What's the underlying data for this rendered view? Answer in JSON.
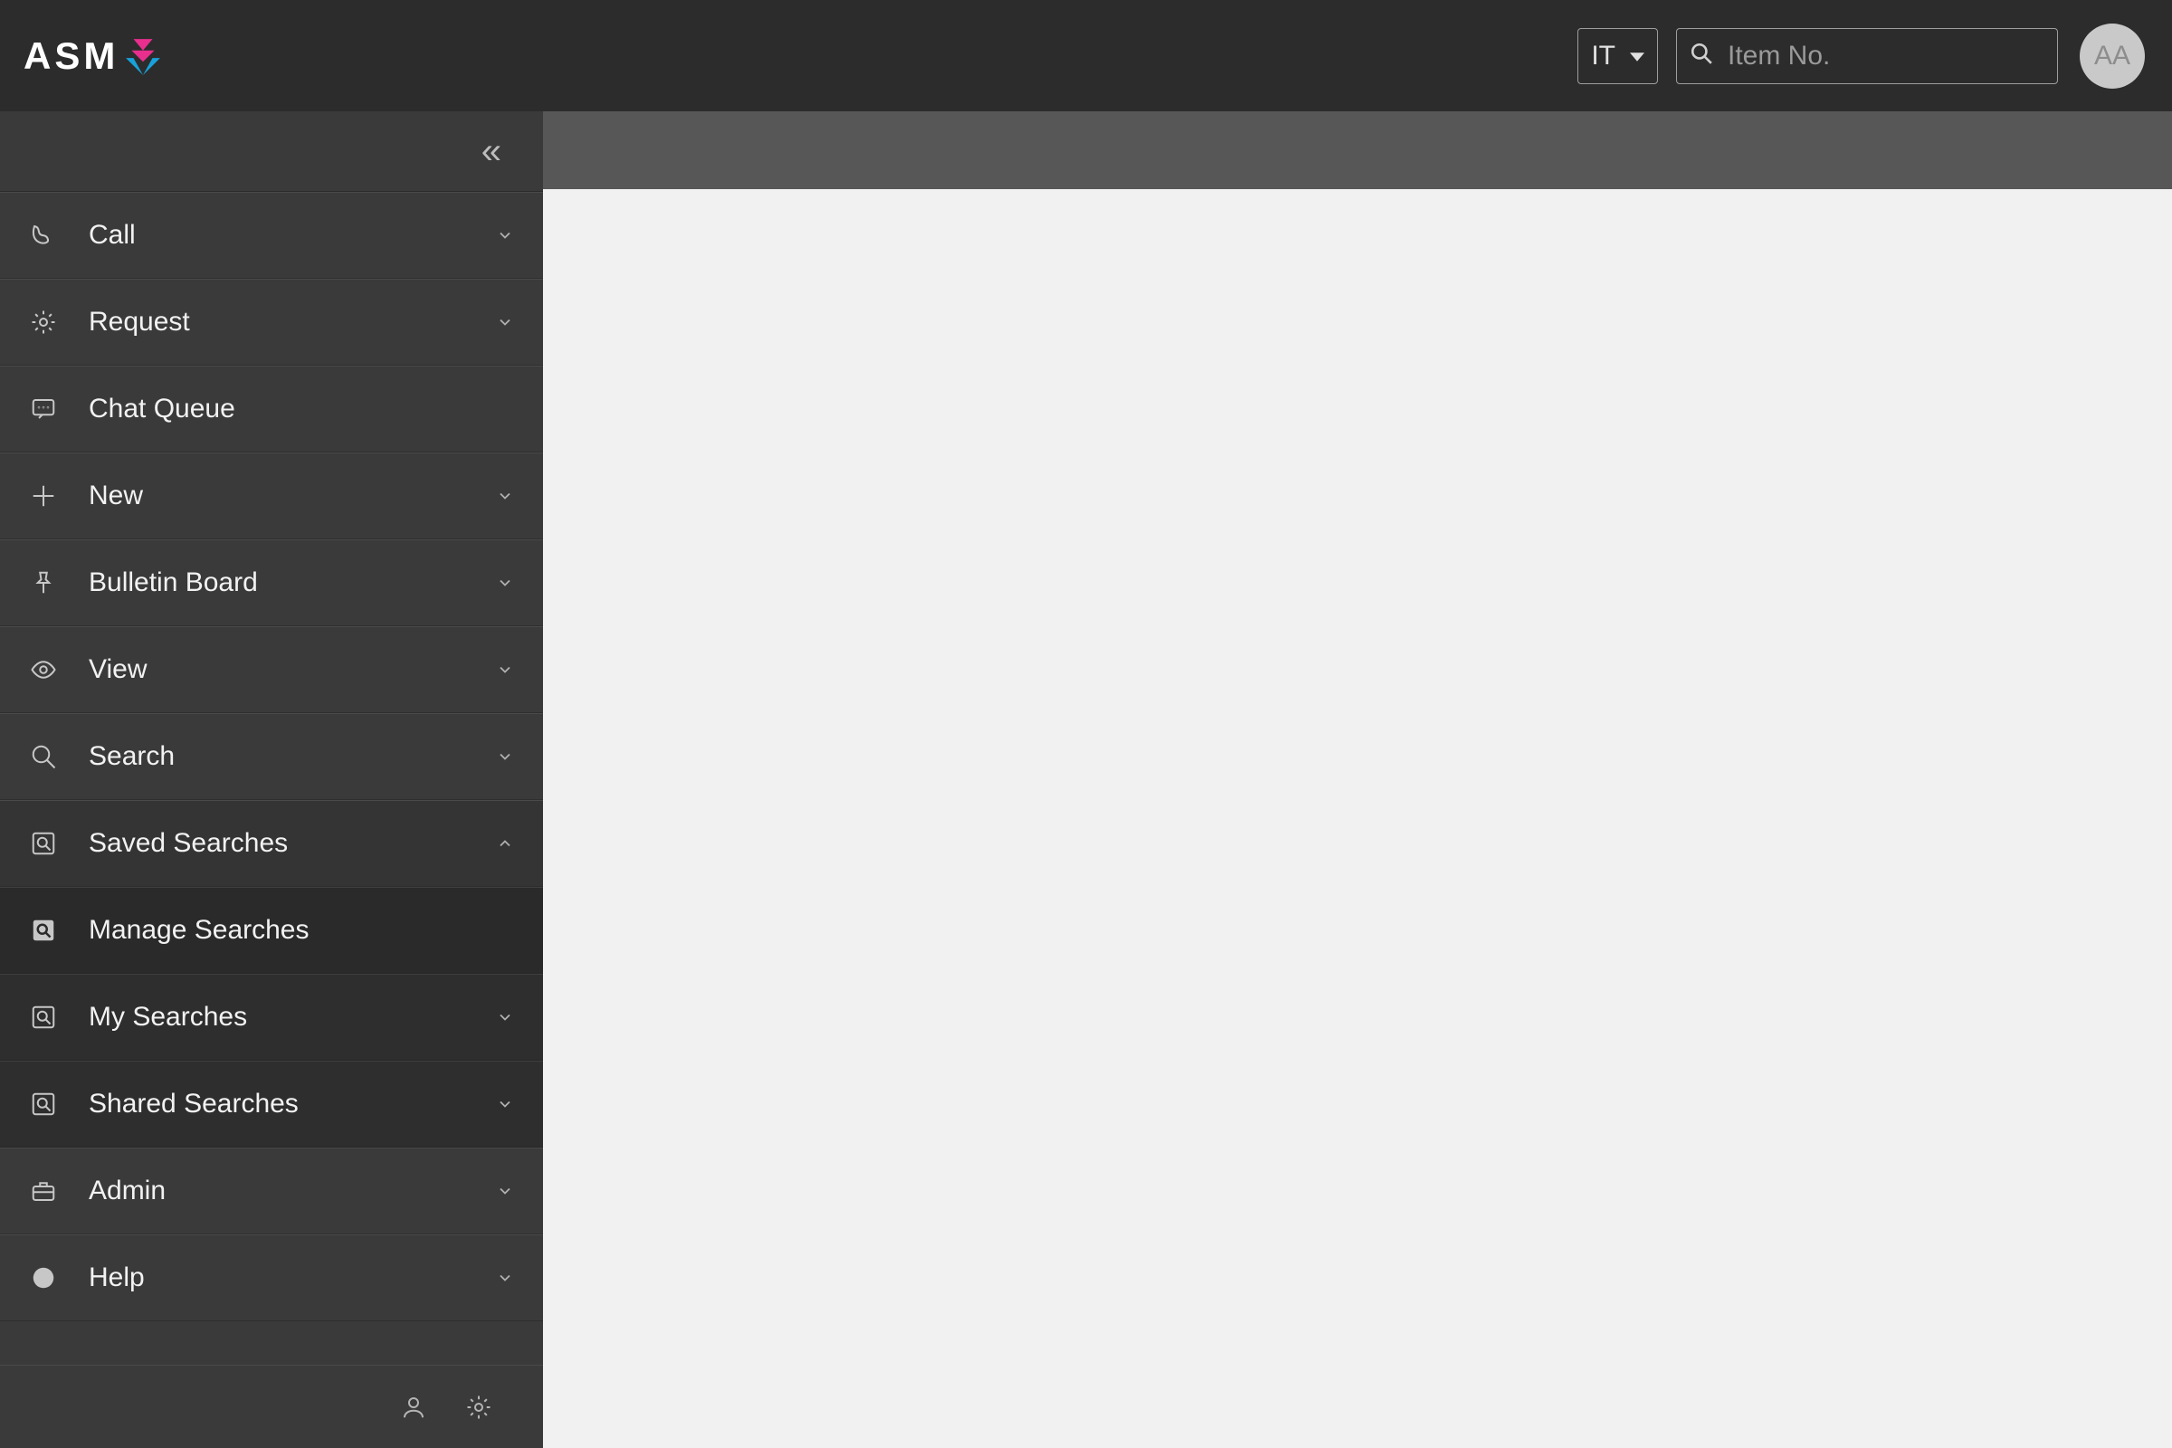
{
  "brand": {
    "name": "ASM"
  },
  "header": {
    "language": "IT",
    "search_placeholder": "Item No.",
    "avatar_initials": "AA"
  },
  "sidebar": {
    "collapse_glyph": "«",
    "items": [
      {
        "key": "call",
        "label": "Call",
        "icon": "phone",
        "expandable": true
      },
      {
        "key": "request",
        "label": "Request",
        "icon": "gear",
        "expandable": true
      },
      {
        "key": "chat",
        "label": "Chat Queue",
        "icon": "chat",
        "expandable": false
      },
      {
        "key": "new",
        "label": "New",
        "icon": "plus",
        "expandable": true
      },
      {
        "key": "bulletin",
        "label": "Bulletin Board",
        "icon": "pin",
        "expandable": true
      },
      {
        "key": "view",
        "label": "View",
        "icon": "eye",
        "expandable": true
      },
      {
        "key": "search",
        "label": "Search",
        "icon": "search",
        "expandable": true
      },
      {
        "key": "saved",
        "label": "Saved Searches",
        "icon": "saved-search",
        "expandable": true,
        "expanded": true,
        "children": [
          {
            "key": "manage",
            "label": "Manage Searches",
            "icon": "saved-search-solid",
            "expandable": false,
            "active": true
          },
          {
            "key": "mine",
            "label": "My Searches",
            "icon": "saved-search",
            "expandable": true
          },
          {
            "key": "shared",
            "label": "Shared Searches",
            "icon": "saved-search",
            "expandable": true
          }
        ]
      },
      {
        "key": "admin",
        "label": "Admin",
        "icon": "briefcase",
        "expandable": true
      },
      {
        "key": "help",
        "label": "Help",
        "icon": "help",
        "expandable": true
      }
    ]
  }
}
